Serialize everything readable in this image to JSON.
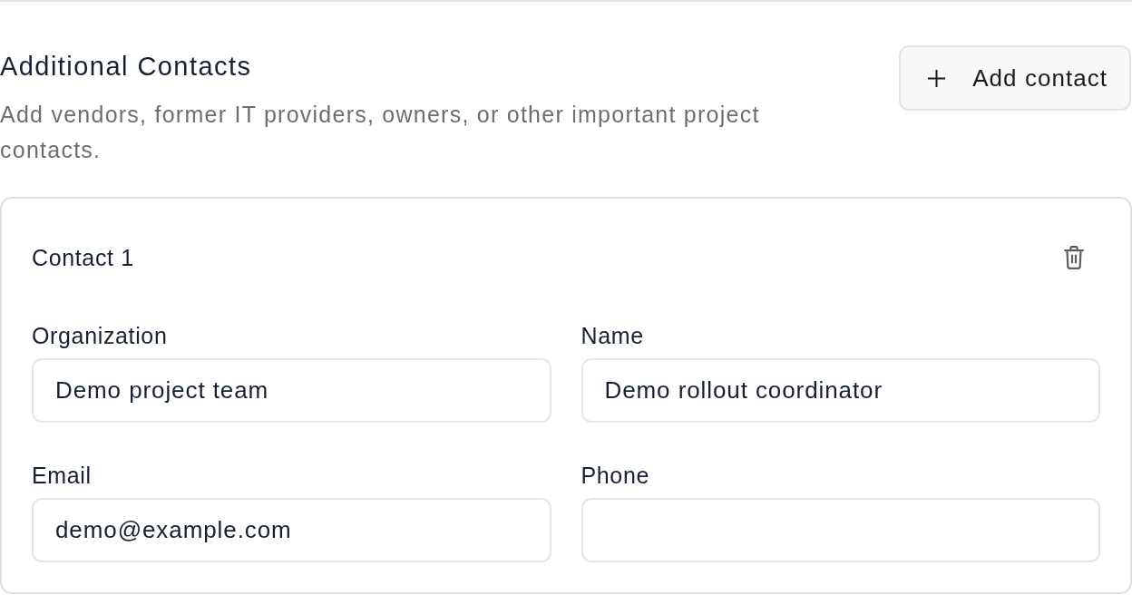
{
  "section": {
    "title": "Additional Contacts",
    "description": "Add vendors, former IT providers, owners, or other important project contacts.",
    "add_button": {
      "label": "Add contact"
    }
  },
  "contacts": [
    {
      "title": "Contact 1",
      "fields": [
        {
          "label": "Organization",
          "value": "Demo project team"
        },
        {
          "label": "Name",
          "value": "Demo rollout coordinator"
        },
        {
          "label": "Email",
          "value": "demo@example.com"
        },
        {
          "label": "Phone"
        }
      ]
    }
  ]
}
